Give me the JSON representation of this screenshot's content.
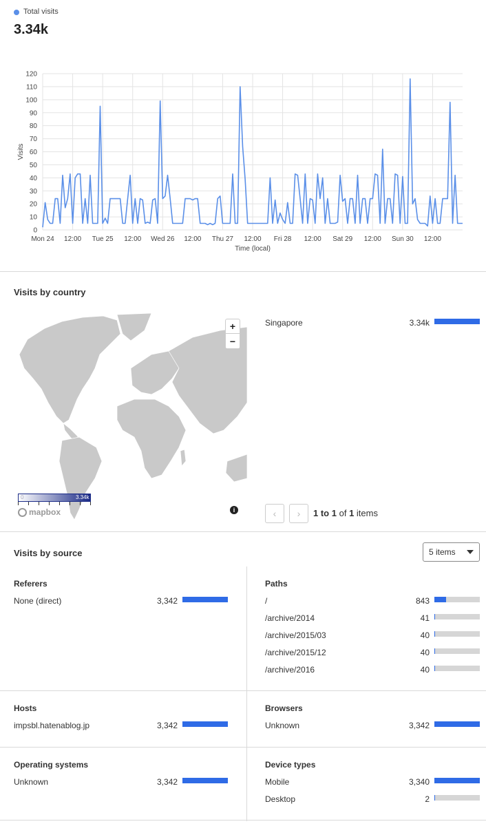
{
  "header": {
    "legend_label": "Total visits",
    "total": "3.34k",
    "series_color": "#5a8fe8"
  },
  "chart_data": {
    "type": "line",
    "xlabel": "Time (local)",
    "ylabel": "Visits",
    "ylim": [
      0,
      120
    ],
    "yticks": [
      0,
      10,
      20,
      30,
      40,
      50,
      60,
      70,
      80,
      90,
      100,
      110,
      120
    ],
    "x_tick_labels": [
      "Mon 24",
      "12:00",
      "Tue 25",
      "12:00",
      "Wed 26",
      "12:00",
      "Thu 27",
      "12:00",
      "Fri 28",
      "12:00",
      "Sat 29",
      "12:00",
      "Sun 30",
      "12:00"
    ],
    "x_range_hours": [
      0,
      168
    ],
    "grid": true,
    "series": [
      {
        "values": [
          [
            0,
            2
          ],
          [
            1,
            21
          ],
          [
            2,
            8
          ],
          [
            3,
            5
          ],
          [
            4,
            5
          ],
          [
            5,
            24
          ],
          [
            6,
            24
          ],
          [
            7,
            5
          ],
          [
            8,
            42
          ],
          [
            9,
            17
          ],
          [
            10,
            24
          ],
          [
            11,
            43
          ],
          [
            12,
            5
          ],
          [
            13,
            40
          ],
          [
            14,
            43
          ],
          [
            15,
            43
          ],
          [
            16,
            5
          ],
          [
            17,
            24
          ],
          [
            18,
            5
          ],
          [
            19,
            42
          ],
          [
            20,
            5
          ],
          [
            21,
            5
          ],
          [
            22,
            5
          ],
          [
            23,
            95
          ],
          [
            24,
            5
          ],
          [
            25,
            9
          ],
          [
            26,
            5
          ],
          [
            27,
            24
          ],
          [
            28,
            24
          ],
          [
            29,
            24
          ],
          [
            30,
            24
          ],
          [
            31,
            24
          ],
          [
            32,
            5
          ],
          [
            33,
            5
          ],
          [
            34,
            24
          ],
          [
            35,
            42
          ],
          [
            36,
            5
          ],
          [
            37,
            24
          ],
          [
            38,
            5
          ],
          [
            39,
            24
          ],
          [
            40,
            23
          ],
          [
            41,
            5
          ],
          [
            42,
            6
          ],
          [
            43,
            5
          ],
          [
            44,
            23
          ],
          [
            45,
            24
          ],
          [
            46,
            5
          ],
          [
            47,
            99
          ],
          [
            48,
            24
          ],
          [
            49,
            26
          ],
          [
            50,
            42
          ],
          [
            51,
            24
          ],
          [
            52,
            5
          ],
          [
            53,
            5
          ],
          [
            54,
            5
          ],
          [
            55,
            5
          ],
          [
            56,
            5
          ],
          [
            57,
            24
          ],
          [
            58,
            24
          ],
          [
            59,
            24
          ],
          [
            60,
            23
          ],
          [
            61,
            24
          ],
          [
            62,
            24
          ],
          [
            63,
            5
          ],
          [
            64,
            5
          ],
          [
            65,
            5
          ],
          [
            66,
            4
          ],
          [
            67,
            5
          ],
          [
            68,
            4
          ],
          [
            69,
            5
          ],
          [
            70,
            24
          ],
          [
            71,
            26
          ],
          [
            72,
            5
          ],
          [
            73,
            5
          ],
          [
            74,
            5
          ],
          [
            75,
            5
          ],
          [
            76,
            43
          ],
          [
            77,
            5
          ],
          [
            78,
            5
          ],
          [
            79,
            110
          ],
          [
            80,
            64
          ],
          [
            81,
            39
          ],
          [
            82,
            5
          ],
          [
            83,
            5
          ],
          [
            84,
            5
          ],
          [
            85,
            5
          ],
          [
            86,
            5
          ],
          [
            87,
            5
          ],
          [
            88,
            5
          ],
          [
            89,
            5
          ],
          [
            90,
            5
          ],
          [
            91,
            40
          ],
          [
            92,
            5
          ],
          [
            93,
            23
          ],
          [
            94,
            5
          ],
          [
            95,
            13
          ],
          [
            96,
            8
          ],
          [
            97,
            5
          ],
          [
            98,
            21
          ],
          [
            99,
            5
          ],
          [
            100,
            5
          ],
          [
            101,
            43
          ],
          [
            102,
            42
          ],
          [
            103,
            24
          ],
          [
            104,
            5
          ],
          [
            105,
            43
          ],
          [
            106,
            5
          ],
          [
            107,
            24
          ],
          [
            108,
            23
          ],
          [
            109,
            5
          ],
          [
            110,
            43
          ],
          [
            111,
            24
          ],
          [
            112,
            40
          ],
          [
            113,
            5
          ],
          [
            114,
            24
          ],
          [
            115,
            5
          ],
          [
            116,
            5
          ],
          [
            117,
            5
          ],
          [
            118,
            6
          ],
          [
            119,
            42
          ],
          [
            120,
            22
          ],
          [
            121,
            24
          ],
          [
            122,
            5
          ],
          [
            123,
            24
          ],
          [
            124,
            24
          ],
          [
            125,
            5
          ],
          [
            126,
            42
          ],
          [
            127,
            5
          ],
          [
            128,
            24
          ],
          [
            129,
            24
          ],
          [
            130,
            5
          ],
          [
            131,
            24
          ],
          [
            132,
            24
          ],
          [
            133,
            43
          ],
          [
            134,
            42
          ],
          [
            135,
            5
          ],
          [
            136,
            62
          ],
          [
            137,
            5
          ],
          [
            138,
            24
          ],
          [
            139,
            24
          ],
          [
            140,
            5
          ],
          [
            141,
            43
          ],
          [
            142,
            42
          ],
          [
            143,
            5
          ],
          [
            144,
            41
          ],
          [
            145,
            5
          ],
          [
            146,
            5
          ],
          [
            147,
            116
          ],
          [
            148,
            20
          ],
          [
            149,
            24
          ],
          [
            150,
            8
          ],
          [
            151,
            5
          ],
          [
            152,
            5
          ],
          [
            153,
            5
          ],
          [
            154,
            3
          ],
          [
            155,
            26
          ],
          [
            156,
            5
          ],
          [
            157,
            24
          ],
          [
            158,
            5
          ],
          [
            159,
            5
          ],
          [
            160,
            24
          ],
          [
            161,
            24
          ],
          [
            162,
            24
          ],
          [
            163,
            98
          ],
          [
            164,
            5
          ],
          [
            165,
            42
          ],
          [
            166,
            5
          ],
          [
            167,
            5
          ],
          [
            168,
            5
          ],
          [
            169,
            5
          ],
          [
            170,
            5
          ],
          [
            171,
            40
          ],
          [
            172,
            5
          ],
          [
            173,
            5
          ],
          [
            174,
            21
          ]
        ]
      }
    ]
  },
  "country": {
    "title": "Visits by country",
    "rows": [
      {
        "label": "Singapore",
        "value": "3.34k",
        "fraction": 1.0
      }
    ],
    "zoom_in": "+",
    "zoom_out": "−",
    "scale_min": "0",
    "scale_max": "3.34k",
    "map_logo": "mapbox",
    "info_icon": "i",
    "pager_prev": "‹",
    "pager_next": "›",
    "pager": {
      "range": "1 to 1",
      "of": "of",
      "total": "1",
      "suffix": "items"
    }
  },
  "source": {
    "title": "Visits by source",
    "items_select": "5 items",
    "referers": {
      "title": "Referers",
      "rows": [
        {
          "label": "None (direct)",
          "value": "3,342",
          "fraction": 1.0
        }
      ]
    },
    "paths": {
      "title": "Paths",
      "rows": [
        {
          "label": "/",
          "value": "843",
          "fraction": 0.252
        },
        {
          "label": "/archive/2014",
          "value": "41",
          "fraction": 0.012
        },
        {
          "label": "/archive/2015/03",
          "value": "40",
          "fraction": 0.012
        },
        {
          "label": "/archive/2015/12",
          "value": "40",
          "fraction": 0.012
        },
        {
          "label": "/archive/2016",
          "value": "40",
          "fraction": 0.012
        }
      ]
    },
    "hosts": {
      "title": "Hosts",
      "rows": [
        {
          "label": "impsbl.hatenablog.jp",
          "value": "3,342",
          "fraction": 1.0
        }
      ]
    },
    "browsers": {
      "title": "Browsers",
      "rows": [
        {
          "label": "Unknown",
          "value": "3,342",
          "fraction": 1.0
        }
      ]
    },
    "os": {
      "title": "Operating systems",
      "rows": [
        {
          "label": "Unknown",
          "value": "3,342",
          "fraction": 1.0
        }
      ]
    },
    "devices": {
      "title": "Device types",
      "rows": [
        {
          "label": "Mobile",
          "value": "3,340",
          "fraction": 0.9994
        },
        {
          "label": "Desktop",
          "value": "2",
          "fraction": 0.0006
        }
      ]
    }
  }
}
